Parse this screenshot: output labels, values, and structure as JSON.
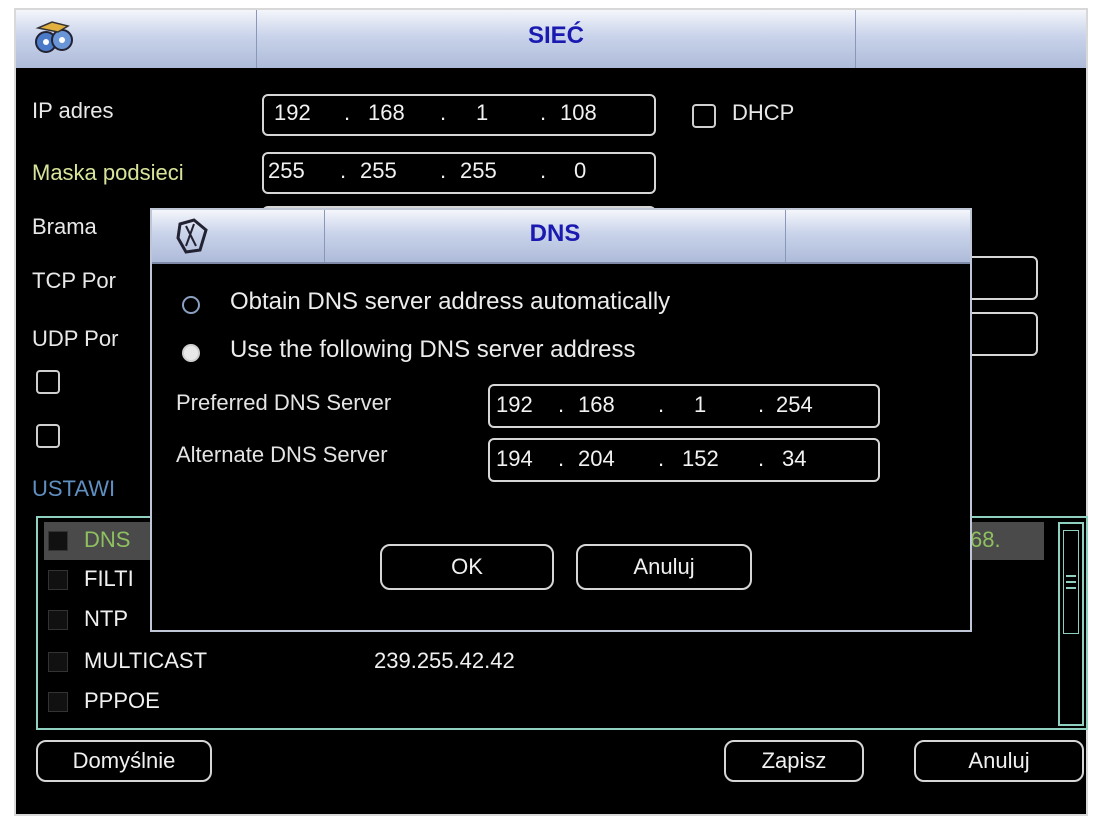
{
  "window": {
    "title": "SIEĆ"
  },
  "network": {
    "ip_label": "IP adres",
    "ip": [
      "192",
      "168",
      "1",
      "108"
    ],
    "dhcp_label": "DHCP",
    "mask_label": "Maska podsieci",
    "mask": [
      "255",
      "255",
      "255",
      "0"
    ],
    "gateway_label": "Brama",
    "tcp_label": "TCP Por",
    "udp_label": "UDP Por",
    "advanced_label": "USTAWI"
  },
  "advanced_list": [
    {
      "name": "DNS",
      "value": "68."
    },
    {
      "name": "FILTI",
      "value": ""
    },
    {
      "name": "NTP",
      "value": ""
    },
    {
      "name": "MULTICAST",
      "value": "239.255.42.42"
    },
    {
      "name": "PPPOE",
      "value": ""
    }
  ],
  "buttons": {
    "default": "Domyślnie",
    "save": "Zapisz",
    "cancel": "Anuluj"
  },
  "dns_dialog": {
    "title": "DNS",
    "option_auto": "Obtain DNS server address automatically",
    "option_manual": "Use the following DNS server address",
    "selected_option": "manual",
    "preferred_label": "Preferred DNS Server",
    "preferred": [
      "192",
      "168",
      "1",
      "254"
    ],
    "alternate_label": "Alternate DNS Server",
    "alternate": [
      "194",
      "204",
      "152",
      "34"
    ],
    "ok": "OK",
    "cancel": "Anuluj"
  },
  "colors": {
    "title_text": "#1a1ab0",
    "highlight": "#7fb04a",
    "list_border": "#8fd0c0"
  }
}
